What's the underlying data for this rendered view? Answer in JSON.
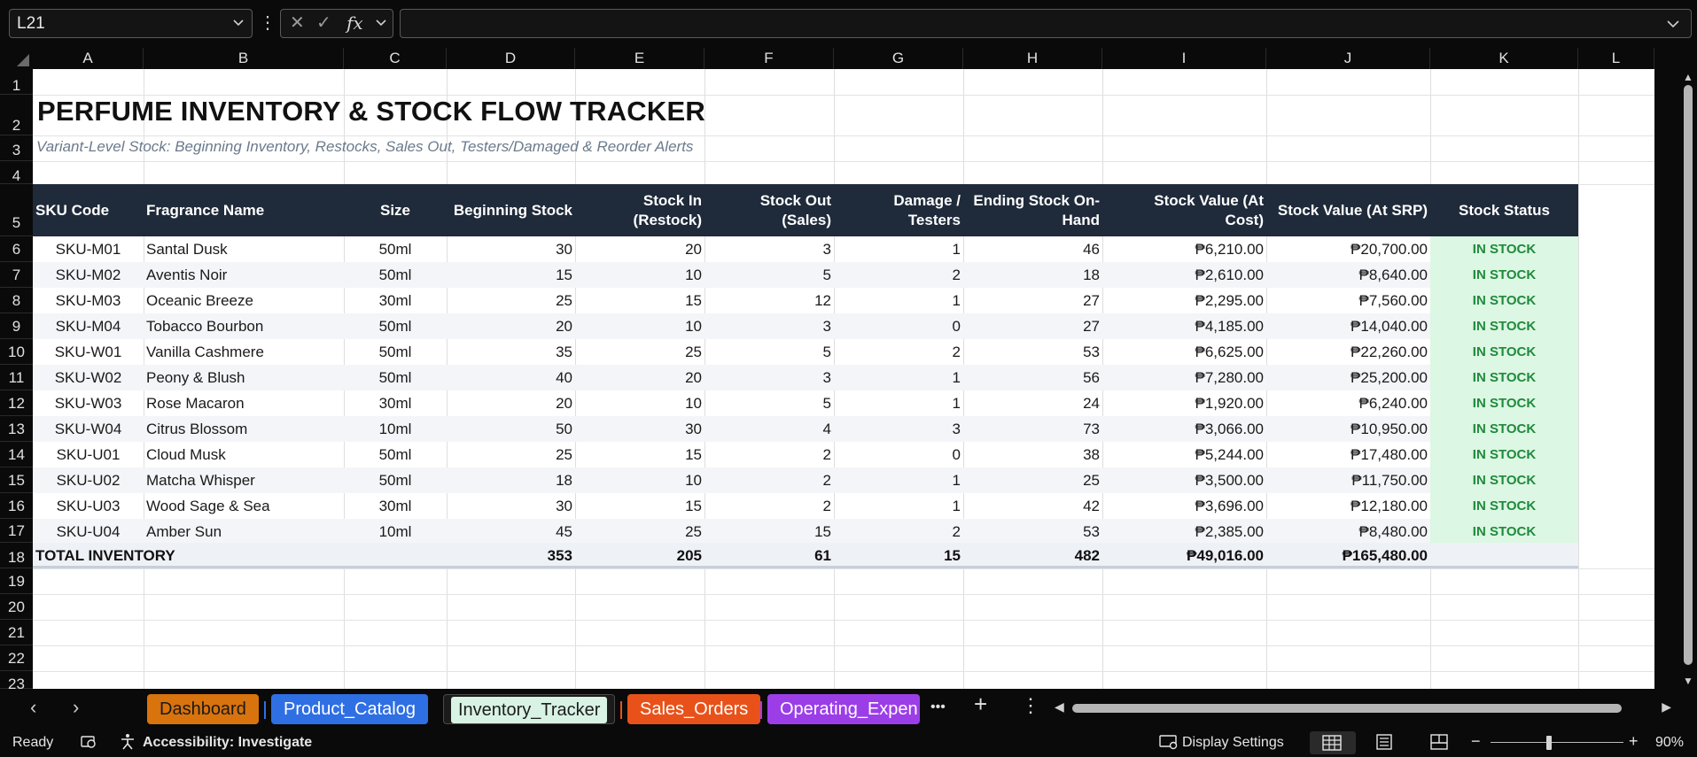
{
  "formula_bar": {
    "name_box": "L21",
    "fx_label": "fx",
    "cancel_glyph": "✕",
    "enter_glyph": "✓"
  },
  "columns": [
    "A",
    "B",
    "C",
    "D",
    "E",
    "F",
    "G",
    "H",
    "I",
    "J",
    "K",
    "L"
  ],
  "rows": [
    "1",
    "2",
    "3",
    "4",
    "5",
    "6",
    "7",
    "8",
    "9",
    "10",
    "11",
    "12",
    "13",
    "14",
    "15",
    "16",
    "17",
    "18",
    "19",
    "20",
    "21",
    "22",
    "23"
  ],
  "sheet": {
    "title": "PERFUME INVENTORY & STOCK FLOW TRACKER",
    "subtitle": "Variant-Level Stock: Beginning Inventory, Restocks, Sales Out, Testers/Damaged & Reorder Alerts",
    "headers": {
      "sku": "SKU Code",
      "name": "Fragrance Name",
      "size": "Size",
      "beginning": "Beginning Stock",
      "stock_in_1": "Stock In",
      "stock_in_2": "(Restock)",
      "stock_out_1": "Stock Out",
      "stock_out_2": "(Sales)",
      "damage_1": "Damage /",
      "damage_2": "Testers",
      "ending_1": "Ending Stock On-",
      "ending_2": "Hand",
      "value_cost_1": "Stock Value (At",
      "value_cost_2": "Cost)",
      "value_srp": "Stock Value (At SRP)",
      "status": "Stock Status"
    },
    "items": [
      {
        "sku": "SKU-M01",
        "name": "Santal Dusk",
        "size": "50ml",
        "beginning": "30",
        "stock_in": "20",
        "stock_out": "3",
        "damage": "1",
        "ending": "46",
        "value_cost": "₱6,210.00",
        "value_srp": "₱20,700.00",
        "status": "IN STOCK"
      },
      {
        "sku": "SKU-M02",
        "name": "Aventis Noir",
        "size": "50ml",
        "beginning": "15",
        "stock_in": "10",
        "stock_out": "5",
        "damage": "2",
        "ending": "18",
        "value_cost": "₱2,610.00",
        "value_srp": "₱8,640.00",
        "status": "IN STOCK"
      },
      {
        "sku": "SKU-M03",
        "name": "Oceanic Breeze",
        "size": "30ml",
        "beginning": "25",
        "stock_in": "15",
        "stock_out": "12",
        "damage": "1",
        "ending": "27",
        "value_cost": "₱2,295.00",
        "value_srp": "₱7,560.00",
        "status": "IN STOCK"
      },
      {
        "sku": "SKU-M04",
        "name": "Tobacco Bourbon",
        "size": "50ml",
        "beginning": "20",
        "stock_in": "10",
        "stock_out": "3",
        "damage": "0",
        "ending": "27",
        "value_cost": "₱4,185.00",
        "value_srp": "₱14,040.00",
        "status": "IN STOCK"
      },
      {
        "sku": "SKU-W01",
        "name": "Vanilla Cashmere",
        "size": "50ml",
        "beginning": "35",
        "stock_in": "25",
        "stock_out": "5",
        "damage": "2",
        "ending": "53",
        "value_cost": "₱6,625.00",
        "value_srp": "₱22,260.00",
        "status": "IN STOCK"
      },
      {
        "sku": "SKU-W02",
        "name": "Peony & Blush",
        "size": "50ml",
        "beginning": "40",
        "stock_in": "20",
        "stock_out": "3",
        "damage": "1",
        "ending": "56",
        "value_cost": "₱7,280.00",
        "value_srp": "₱25,200.00",
        "status": "IN STOCK"
      },
      {
        "sku": "SKU-W03",
        "name": "Rose Macaron",
        "size": "30ml",
        "beginning": "20",
        "stock_in": "10",
        "stock_out": "5",
        "damage": "1",
        "ending": "24",
        "value_cost": "₱1,920.00",
        "value_srp": "₱6,240.00",
        "status": "IN STOCK"
      },
      {
        "sku": "SKU-W04",
        "name": "Citrus Blossom",
        "size": "10ml",
        "beginning": "50",
        "stock_in": "30",
        "stock_out": "4",
        "damage": "3",
        "ending": "73",
        "value_cost": "₱3,066.00",
        "value_srp": "₱10,950.00",
        "status": "IN STOCK"
      },
      {
        "sku": "SKU-U01",
        "name": "Cloud Musk",
        "size": "50ml",
        "beginning": "25",
        "stock_in": "15",
        "stock_out": "2",
        "damage": "0",
        "ending": "38",
        "value_cost": "₱5,244.00",
        "value_srp": "₱17,480.00",
        "status": "IN STOCK"
      },
      {
        "sku": "SKU-U02",
        "name": "Matcha Whisper",
        "size": "50ml",
        "beginning": "18",
        "stock_in": "10",
        "stock_out": "2",
        "damage": "1",
        "ending": "25",
        "value_cost": "₱3,500.00",
        "value_srp": "₱11,750.00",
        "status": "IN STOCK"
      },
      {
        "sku": "SKU-U03",
        "name": "Wood Sage & Sea",
        "size": "30ml",
        "beginning": "30",
        "stock_in": "15",
        "stock_out": "2",
        "damage": "1",
        "ending": "42",
        "value_cost": "₱3,696.00",
        "value_srp": "₱12,180.00",
        "status": "IN STOCK"
      },
      {
        "sku": "SKU-U04",
        "name": "Amber Sun",
        "size": "10ml",
        "beginning": "45",
        "stock_in": "25",
        "stock_out": "15",
        "damage": "2",
        "ending": "53",
        "value_cost": "₱2,385.00",
        "value_srp": "₱8,480.00",
        "status": "IN STOCK"
      }
    ],
    "total": {
      "label": "TOTAL INVENTORY",
      "beginning": "353",
      "stock_in": "205",
      "stock_out": "61",
      "damage": "15",
      "ending": "482",
      "value_cost": "₱49,016.00",
      "value_srp": "₱165,480.00"
    }
  },
  "tabs": [
    {
      "label": "Dashboard",
      "color": "#d9730d",
      "text_color": "#1a1a1a"
    },
    {
      "label": "Product_Catalog",
      "color": "#2f6fe4",
      "text_color": "#ffffff"
    },
    {
      "label": "Inventory_Tracker",
      "color": "#d8f3e4",
      "text_color": "#1a1a1a",
      "active": true
    },
    {
      "label": "Sales_Orders",
      "color": "#e8521a",
      "text_color": "#ffffff"
    },
    {
      "label": "Operating_Expen",
      "color": "#9b3ee8",
      "text_color": "#ffffff"
    }
  ],
  "tab_controls": {
    "more": "•••",
    "add": "+",
    "options": "⋮",
    "prev": "‹",
    "next": "›"
  },
  "status_bar": {
    "ready": "Ready",
    "accessibility": "Accessibility: Investigate",
    "display_settings": "Display Settings",
    "zoom_minus": "−",
    "zoom_plus": "+",
    "zoom": "90%"
  },
  "colors": {
    "header_band": "#1f2a3a",
    "status_bg": "#dcf7e3",
    "status_text": "#1f8a3c"
  }
}
